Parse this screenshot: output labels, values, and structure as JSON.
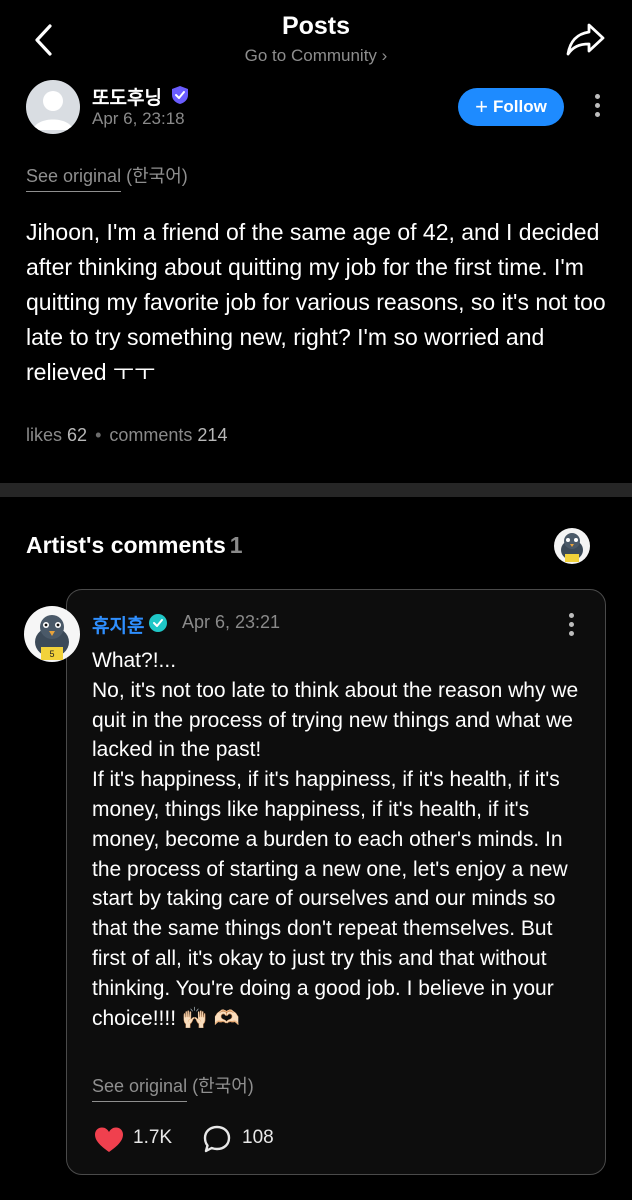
{
  "header": {
    "title": "Posts",
    "subtitle": "Go to Community",
    "back_icon": "chevron-left-icon",
    "share_icon": "share-arrow-icon"
  },
  "post": {
    "author": "또도후닝",
    "date": "Apr 6, 23:18",
    "follow_label": "Follow",
    "see_original": "See original",
    "see_original_lang": "(한국어)",
    "body": "Jihoon, I'm a friend of the same age of 42, and I decided after thinking about quitting my job for the first time. I'm quitting my favorite job for various reasons, so it's not too late to try something new, right? I'm so worried and relieved ㅜㅜ",
    "likes_label": "likes",
    "likes": "62",
    "comments_label": "comments",
    "comments": "214"
  },
  "artist_comments": {
    "title": "Artist's comments",
    "count": "1",
    "comment": {
      "author": "휴지훈",
      "date": "Apr 6, 23:21",
      "body": "What?!...\nNo, it's not too late to think about the reason why we quit in the process of trying new things and what we lacked in the past!\nIf it's happiness, if it's happiness, if it's health, if it's money, things like happiness, if it's health, if it's money, become a burden to each other's minds. In the process of starting a new one, let's enjoy a new start by taking care of ourselves and our minds so that the same things don't repeat themselves. But first of all, it's okay to just try this and that without thinking. You're doing a good job. I believe in your choice!!!! 🙌🏻 🫶🏻",
      "see_original": "See original",
      "see_original_lang": "(한국어)",
      "likes": "1.7K",
      "replies": "108"
    }
  },
  "colors": {
    "accent": "#1e8bff",
    "artist_name": "#2f8fff",
    "heart": "#f0404e",
    "badge_purple": "#6a5cff",
    "badge_teal": "#1fc7c7"
  }
}
